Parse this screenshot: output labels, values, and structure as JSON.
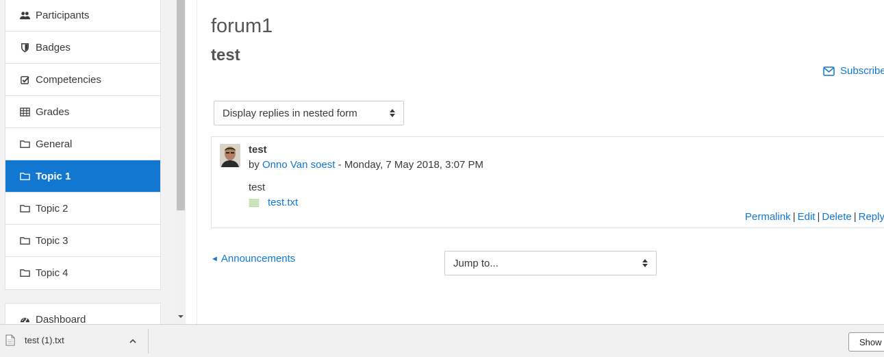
{
  "sidebar": {
    "items": [
      {
        "label": "Participants",
        "icon": "users-icon"
      },
      {
        "label": "Badges",
        "icon": "shield-icon"
      },
      {
        "label": "Competencies",
        "icon": "check-square-icon"
      },
      {
        "label": "Grades",
        "icon": "table-icon"
      },
      {
        "label": "General",
        "icon": "folder-icon"
      },
      {
        "label": "Topic 1",
        "icon": "folder-icon",
        "active": true
      },
      {
        "label": "Topic 2",
        "icon": "folder-icon"
      },
      {
        "label": "Topic 3",
        "icon": "folder-icon"
      },
      {
        "label": "Topic 4",
        "icon": "folder-icon"
      }
    ],
    "secondary": [
      {
        "label": "Dashboard",
        "icon": "dashboard-icon"
      }
    ]
  },
  "main": {
    "title": "forum1",
    "subtitle": "test",
    "subscribe_label": "Subscribe",
    "display_mode": "Display replies in nested form",
    "post": {
      "subject": "test",
      "by_prefix": "by ",
      "author": "Onno Van soest",
      "date": " - Monday, 7 May 2018, 3:07 PM",
      "message": "test",
      "attachment": "test.txt",
      "commands": [
        "Permalink",
        "Edit",
        "Delete",
        "Reply"
      ]
    },
    "prev_activity": "Announcements",
    "jump_to": "Jump to..."
  },
  "download_bar": {
    "file_name": "test (1).txt",
    "show_all": "Show all"
  },
  "colors": {
    "accent": "#1177d1",
    "sidebar_bg": "#f2f2f2"
  }
}
